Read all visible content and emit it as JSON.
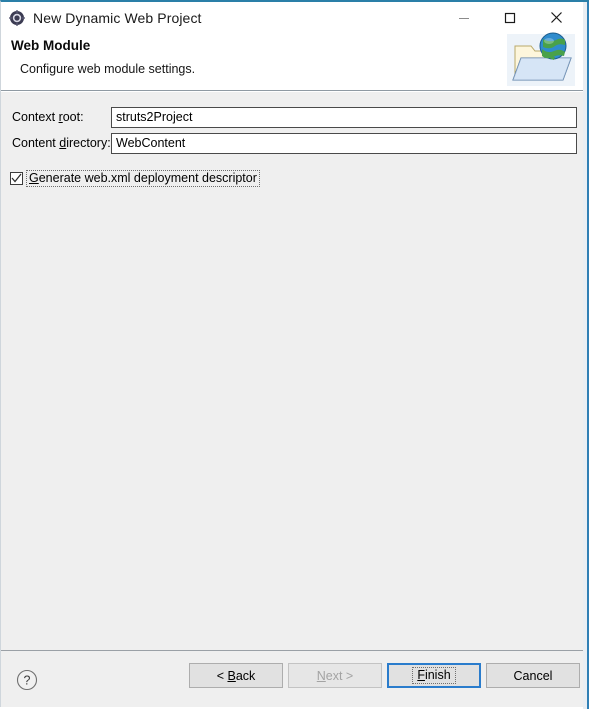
{
  "window": {
    "title": "New Dynamic Web Project",
    "title_icon": "eclipse-wizard-icon",
    "controls": {
      "minimize": "minimize-icon",
      "maximize": "maximize-icon",
      "close": "close-icon"
    }
  },
  "header": {
    "title": "Web Module",
    "subtitle": "Configure web module settings.",
    "graphic": "web-folder-globe-icon"
  },
  "form": {
    "context_root": {
      "label_pre": "Context ",
      "label_mnemonic": "r",
      "label_post": "oot:",
      "value": "struts2Project"
    },
    "content_directory": {
      "label_pre": "Content ",
      "label_mnemonic": "d",
      "label_post": "irectory:",
      "value": "WebContent"
    },
    "generate_webxml": {
      "label_mnemonic": "G",
      "label_post": "enerate web.xml deployment descriptor",
      "checked": true,
      "check_icon": "checkmark-icon"
    }
  },
  "footer": {
    "help": {
      "icon": "help-question-icon",
      "tooltip": "Help"
    },
    "buttons": [
      {
        "name": "back-button",
        "pre": "< ",
        "mnemonic": "B",
        "post": "ack",
        "state": "enabled",
        "default": false
      },
      {
        "name": "next-button",
        "pre": "",
        "mnemonic": "N",
        "post": "ext >",
        "state": "disabled",
        "default": false
      },
      {
        "name": "finish-button",
        "pre": "",
        "mnemonic": "F",
        "post": "inish",
        "state": "enabled",
        "default": true
      },
      {
        "name": "cancel-button",
        "pre": "Cancel",
        "mnemonic": "",
        "post": "",
        "state": "enabled",
        "default": false
      }
    ]
  },
  "colors": {
    "window_border_top": "#2a7fa8",
    "accent_default_button": "#2a7ccc",
    "page_background": "#efefef",
    "field_background": "#ffffff",
    "disabled_text": "#a3a3a3"
  }
}
